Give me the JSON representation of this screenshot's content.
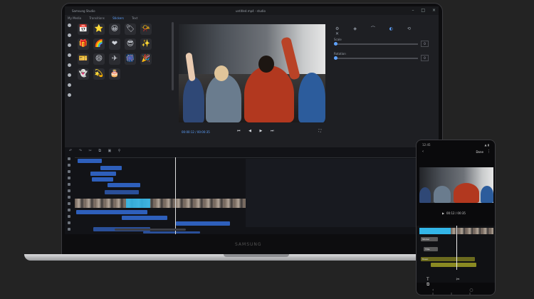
{
  "window": {
    "app_title": "Samsung Studio",
    "file_title": "untitled.mp4 - studio",
    "controls": [
      "–",
      "□",
      "×"
    ]
  },
  "media_tabs": [
    "My Media",
    "Transitions",
    "Stickers",
    "Text"
  ],
  "stickers": [
    {
      "name": "calendar",
      "glyph": "📅"
    },
    {
      "name": "star",
      "glyph": "⭐"
    },
    {
      "name": "smile",
      "glyph": "😀"
    },
    {
      "name": "badge",
      "glyph": "🏷"
    },
    {
      "name": "horn",
      "glyph": "📯"
    },
    {
      "name": "gift",
      "glyph": "🎁"
    },
    {
      "name": "rainbow",
      "glyph": "🌈"
    },
    {
      "name": "heart",
      "glyph": "❤"
    },
    {
      "name": "sunglasses",
      "glyph": "😎"
    },
    {
      "name": "star-small",
      "glyph": "✨"
    },
    {
      "name": "ticket",
      "glyph": "🎫"
    },
    {
      "name": "laugh",
      "glyph": "😄"
    },
    {
      "name": "plane",
      "glyph": "✈"
    },
    {
      "name": "firework",
      "glyph": "🎆"
    },
    {
      "name": "party",
      "glyph": "🎉"
    },
    {
      "name": "ghost",
      "glyph": "👻"
    },
    {
      "name": "sparkle",
      "glyph": "💫"
    },
    {
      "name": "cake",
      "glyph": "🎂"
    }
  ],
  "preview": {
    "timecode": "00:00:12 / 00:00:35",
    "transport": "⏮ ◀ ▶ ⏭",
    "fullscreen": "⛶"
  },
  "properties": {
    "icons": [
      "⚙",
      "◈",
      "⌒",
      "◐",
      "⟲",
      "✕"
    ],
    "rows": [
      {
        "label": "Scale",
        "value": "0"
      },
      {
        "label": "Rotation",
        "value": "0"
      }
    ]
  },
  "timeline": {
    "tools": "↶ ↷ ✂ ⧉ ▣ ⚲"
  },
  "phone": {
    "status_time": "12:45",
    "status_right": "▲ ▮",
    "back": "‹",
    "done": "Done",
    "more": "⋮",
    "timecode": "00:12 / 00:35",
    "clip_labels": [
      "Sticker",
      "Title",
      "Music"
    ],
    "tools": "T ✂ ⧉",
    "nav": "‹ ○ |||"
  },
  "colors": {
    "accent": "#5ea2ff",
    "clip": "#2e5fbb",
    "selection": "#33b6e8"
  }
}
